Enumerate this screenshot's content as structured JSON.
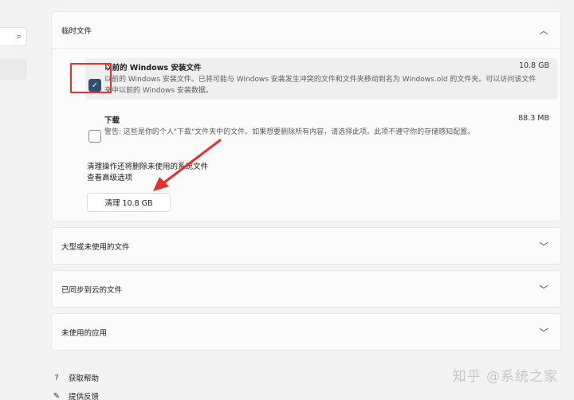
{
  "sidebar": {
    "search_icon": "search-icon"
  },
  "temp_section": {
    "title": "临时文件",
    "items": [
      {
        "title": "以前的 Windows 安装文件",
        "size": "10.8 GB",
        "checked": true,
        "desc": "以前的 Windows 安装文件。已将可能与 Windows 安装发生冲突的文件和文件夹移动到名为 Windows.old 的文件夹。可以访问该文件夹中以前的 Windows 安装数据。"
      },
      {
        "title": "下载",
        "size": "88.3 MB",
        "checked": false,
        "desc": "警告: 这些是你的个人\"下载\"文件夹中的文件。如果想要删除所有内容，请选择此项。此项不遵守你的存储感知配置。"
      }
    ],
    "note": "清理操作还将删除未使用的系统文件",
    "advanced": "查看高级选项",
    "cleanup_button": "清理 10.8 GB"
  },
  "sections": [
    {
      "title": "大型或未使用的文件"
    },
    {
      "title": "已同步到云的文件"
    },
    {
      "title": "未使用的应用"
    }
  ],
  "footer": {
    "help": "获取帮助",
    "feedback": "提供反馈"
  },
  "watermark": "知乎 @系统之家",
  "colors": {
    "highlight": "#e5312b",
    "checkbox": "#2f4f6a"
  }
}
